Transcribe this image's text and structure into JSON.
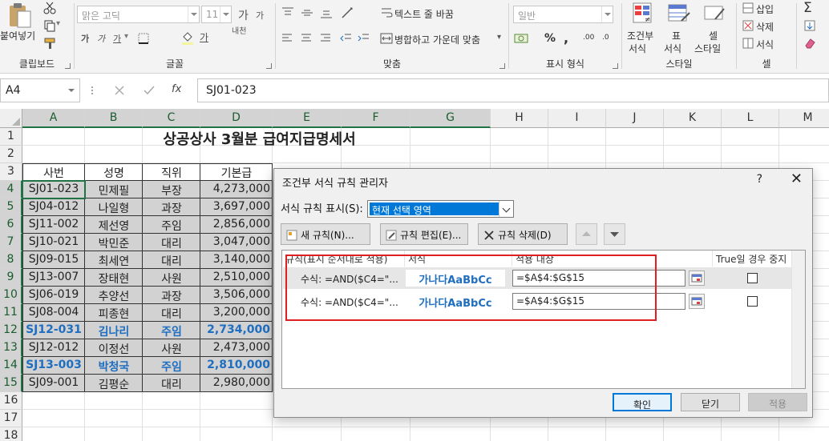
{
  "ribbon": {
    "clipboard": {
      "paste_label": "붙여넣기",
      "group_label": "클립보드"
    },
    "font": {
      "font_name": "맑은 고딕",
      "font_size": "11",
      "group_label": "글꼴",
      "bold": "가",
      "italic": "가",
      "underline": "가",
      "grow": "가",
      "shrink": "가",
      "phonetic": "내천",
      "color_letter": "가"
    },
    "alignment": {
      "wrap_label": "텍스트 줄 바꿈",
      "merge_label": "병합하고 가운데 맞춤",
      "group_label": "맞춤"
    },
    "number": {
      "format": "일반",
      "percent": "%",
      "comma": ",",
      "inc": ".00",
      "dec": ".0",
      "group_label": "표시 형식"
    },
    "styles": {
      "cond_label_1": "조건부",
      "cond_label_2": "서식",
      "table_label_1": "표",
      "table_label_2": "서식",
      "cell_label_1": "셀",
      "cell_label_2": "스타일",
      "group_label": "스타일"
    },
    "cells": {
      "insert": "삽입",
      "delete": "삭제",
      "format": "서식",
      "group_label": "셀"
    },
    "editing": {
      "sigma": "Σ"
    }
  },
  "formula_bar": {
    "name_box": "A4",
    "fx": "fx",
    "formula": "SJ01-023"
  },
  "grid": {
    "columns": [
      "A",
      "B",
      "C",
      "D",
      "E",
      "F",
      "G",
      "H",
      "I",
      "J",
      "K",
      "L",
      "M"
    ],
    "rows": [
      "1",
      "2",
      "3",
      "4",
      "5",
      "6",
      "7",
      "8",
      "9",
      "10",
      "11",
      "12",
      "13",
      "14",
      "15",
      "16",
      "17",
      "18"
    ],
    "title": "상공상사 3월분 급여지급명세서",
    "headers": [
      "사번",
      "성명",
      "직위",
      "기본급"
    ],
    "data": [
      [
        "SJ01-023",
        "민제필",
        "부장",
        "4,273,000"
      ],
      [
        "SJ04-012",
        "나일형",
        "과장",
        "3,697,000"
      ],
      [
        "SJ11-002",
        "제선영",
        "주임",
        "2,856,000"
      ],
      [
        "SJ10-021",
        "박민준",
        "대리",
        "3,047,000"
      ],
      [
        "SJ09-015",
        "최세연",
        "대리",
        "3,140,000"
      ],
      [
        "SJ13-007",
        "장태현",
        "사원",
        "2,510,000"
      ],
      [
        "SJ06-019",
        "추양선",
        "과장",
        "3,506,000"
      ],
      [
        "SJ08-004",
        "피종현",
        "대리",
        "3,200,000"
      ],
      [
        "SJ12-031",
        "김나리",
        "주임",
        "2,734,000"
      ],
      [
        "SJ12-012",
        "이정선",
        "사원",
        "2,473,000"
      ],
      [
        "SJ13-003",
        "박청국",
        "주임",
        "2,810,000"
      ],
      [
        "SJ09-001",
        "김평순",
        "대리",
        "2,980,000"
      ]
    ],
    "highlighted_rows": [
      8,
      10
    ]
  },
  "dialog": {
    "title": "조건부 서식 규칙 관리자",
    "help": "?",
    "close": "✕",
    "show_rules_label": "서식 규칙 표시(S):",
    "show_rules_value": "현재 선택 영역",
    "new_rule": "새 규칙(N)...",
    "edit_rule": "규칙 편집(E)...",
    "delete_rule": "규칙 삭제(D)",
    "headers": {
      "rule": "규칙(표시 순서대로 적용)",
      "format": "서식",
      "applies": "적용 대상",
      "stop": "True일 경우 중지"
    },
    "rules": [
      {
        "rule": "수식: =AND($C4=\"...",
        "preview": "가나다AaBbCc",
        "applies": "=$A$4:$G$15"
      },
      {
        "rule": "수식: =AND($C4=\"...",
        "preview": "가나다AaBbCc",
        "applies": "=$A$4:$G$15"
      }
    ],
    "ok": "확인",
    "cancel": "닫기",
    "apply": "적용"
  }
}
